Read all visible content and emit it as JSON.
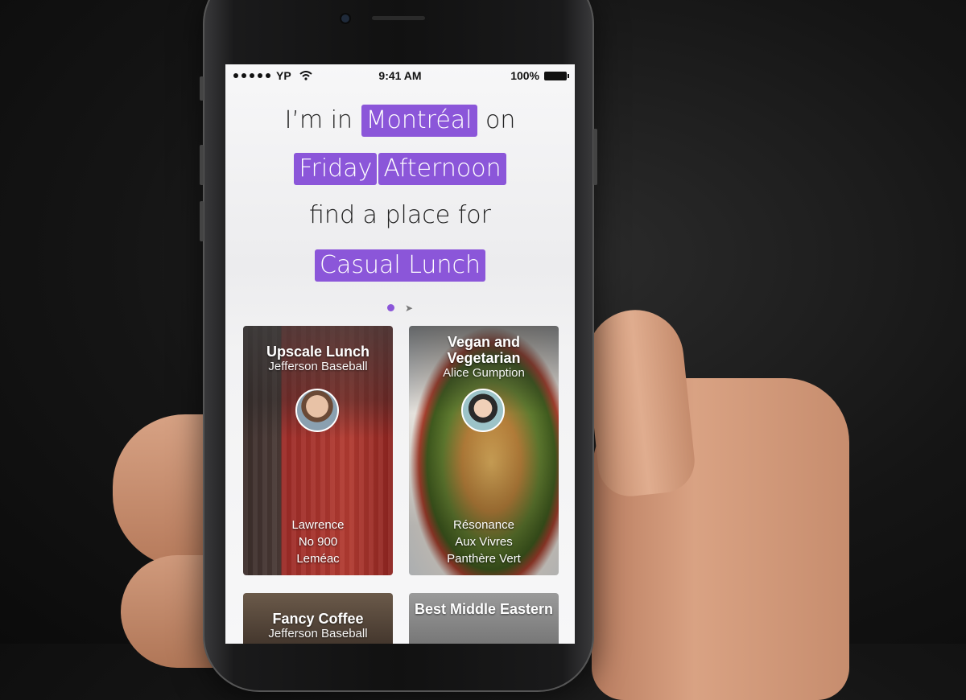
{
  "status_bar": {
    "carrier": "YP",
    "time": "9:41 AM",
    "battery": "100%"
  },
  "query": {
    "line1_prefix": "I’m in",
    "city": "Montréal",
    "line1_suffix": "on",
    "day": "Friday",
    "time_of_day": "Afternoon",
    "line3": "find a place for",
    "occasion": "Casual Lunch"
  },
  "cards": [
    {
      "title": "Upscale Lunch",
      "author": "Jefferson Baseball",
      "places": [
        "Lawrence",
        "No 900",
        "Leméac"
      ]
    },
    {
      "title": "Vegan and Vegetarian",
      "author": "Alice Gumption",
      "places": [
        "Résonance",
        "Aux Vivres",
        "Panthère Vert"
      ]
    },
    {
      "title": "Fancy Coffee",
      "author": "Jefferson Baseball",
      "places": []
    },
    {
      "title": "Best Middle Eastern",
      "author": "",
      "places": []
    }
  ],
  "colors": {
    "accent": "#8b56d9"
  }
}
